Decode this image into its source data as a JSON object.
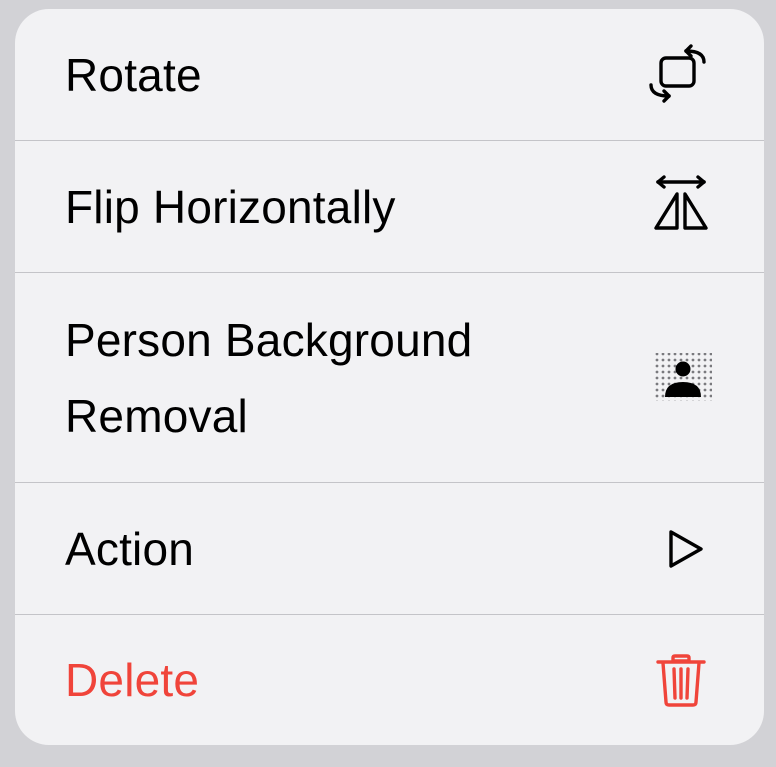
{
  "menu": {
    "items": [
      {
        "label": "Rotate",
        "icon": "rotate-icon",
        "destructive": false
      },
      {
        "label": "Flip Horizontally",
        "icon": "flip-horizontal-icon",
        "destructive": false
      },
      {
        "label": "Person Background Removal",
        "icon": "person-background-removal-icon",
        "destructive": false
      },
      {
        "label": "Action",
        "icon": "play-icon",
        "destructive": false
      },
      {
        "label": "Delete",
        "icon": "trash-icon",
        "destructive": true
      }
    ]
  },
  "colors": {
    "backdrop": "#d2d2d6",
    "menu_background": "#f2f2f4",
    "divider": "#c4c4c8",
    "text": "#000000",
    "destructive": "#f0443a"
  }
}
